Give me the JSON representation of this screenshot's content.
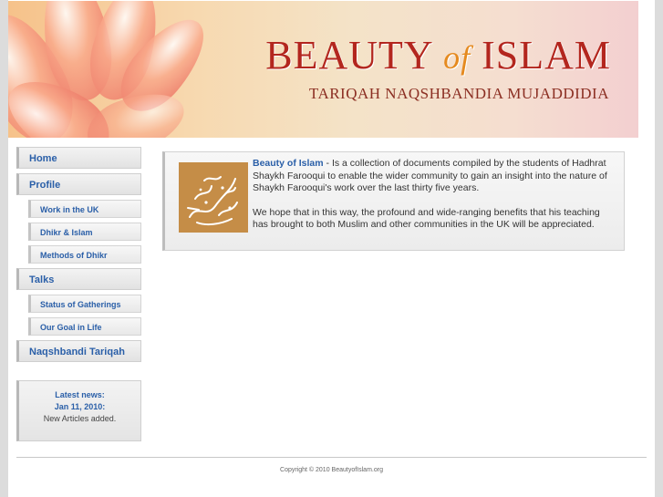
{
  "header": {
    "title_beauty": "BEAUTY",
    "title_of": "of",
    "title_islam": "ISLAM",
    "subtitle": "TARIQAH NAQSHBANDIA MUJADDIDIA"
  },
  "nav": {
    "home": "Home",
    "profile": "Profile",
    "work_uk": "Work in the UK",
    "dhikr_islam": "Dhikr & Islam",
    "methods_dhikr": "Methods of Dhikr",
    "talks": "Talks",
    "status_gatherings": "Status of Gatherings",
    "goal_life": "Our Goal in Life",
    "naqshbandi": "Naqshbandi Tariqah"
  },
  "news": {
    "heading": "Latest news:",
    "date": "Jan 11, 2010:",
    "text": "New Articles added."
  },
  "content": {
    "brand": "Beauty of Islam",
    "para1_rest": " - Is a collection of documents compiled by the students of Hadhrat Shaykh Farooqui to enable the wider community to gain an insight into the nature of Shaykh Farooqui's work over the last thirty five years.",
    "para2": "We hope that in this way, the profound and wide-ranging benefits that his teaching has brought to both Muslim and other communities in the UK will be appreciated."
  },
  "footer": {
    "copyright": "Copyright © 2010 BeautyofIslam.org"
  },
  "colors": {
    "link_blue": "#2a5fa8",
    "title_red": "#b3261e",
    "title_orange": "#e58a1f",
    "calligraphy_bg": "#c58d47"
  },
  "icons": {
    "calligraphy": "arabic-calligraphy-image"
  }
}
